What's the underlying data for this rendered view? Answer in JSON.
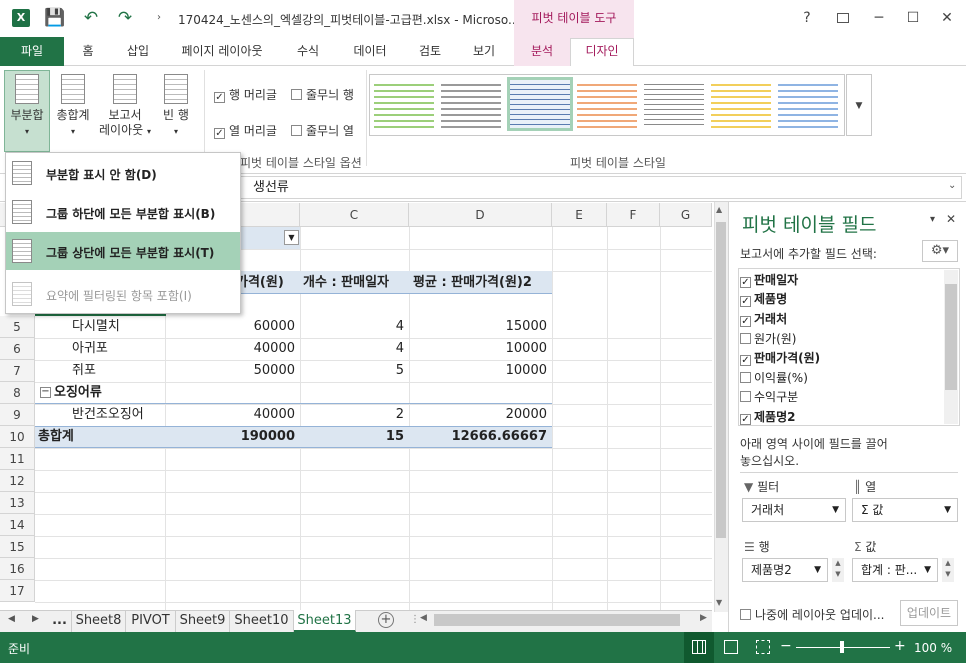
{
  "app": {
    "icon": "X",
    "title": "170424_노센스의_엑셀강의_피벗테이블-고급편.xlsx - Microso...",
    "context_group": "피벗 테이블 도구"
  },
  "window": {
    "help": "?",
    "restore_icon": "restore-icon",
    "minimize": "─",
    "maximize": "☐",
    "close": "✕"
  },
  "tabs": [
    "파일",
    "홈",
    "삽입",
    "페이지 레이아웃",
    "수식",
    "데이터",
    "검토",
    "보기",
    "분석",
    "디자인"
  ],
  "ribbon": {
    "subtotal": "부분합",
    "grand_total": "총합계",
    "report_layout_1": "보고서",
    "report_layout_2": "레이아웃",
    "blank_rows_1": "빈 행",
    "options": [
      "행 머리글",
      "줄무늬 행",
      "열 머리글",
      "줄무늬 열"
    ],
    "options_checked": [
      true,
      false,
      true,
      false
    ],
    "group_options": "피벗 테이블 스타일 옵션",
    "group_styles": "피벗 테이블 스타일"
  },
  "menu": {
    "items": [
      "부분합 표시 안 함(D)",
      "그룹 하단에 모든 부분합 표시(B)",
      "그룹 상단에 모든 부분합 표시(T)",
      "요약에 필터링된 항목 포함(I)"
    ]
  },
  "formula": {
    "value": "생선류"
  },
  "grid": {
    "columns": [
      "C",
      "D",
      "E",
      "F",
      "G"
    ],
    "rows": [
      "5",
      "6",
      "7",
      "8",
      "9",
      "10",
      "11",
      "12",
      "13",
      "14",
      "15",
      "16",
      "17"
    ],
    "header": {
      "b": "가격(원)",
      "c": "개수 : 판매일자",
      "d": "평균 : 판매가격(원)2"
    },
    "data": [
      {
        "a": "다시멸치",
        "b": "60000",
        "c": "4",
        "d": "15000"
      },
      {
        "a": "아귀포",
        "b": "40000",
        "c": "4",
        "d": "10000"
      },
      {
        "a": "쥐포",
        "b": "50000",
        "c": "5",
        "d": "10000"
      },
      {
        "a": "오징어류",
        "b": "",
        "c": "",
        "d": ""
      },
      {
        "a": "반건조오징어",
        "b": "40000",
        "c": "2",
        "d": "20000"
      },
      {
        "a": "총합계",
        "b": "190000",
        "c": "15",
        "d": "12666.66667"
      }
    ],
    "collapse": "⊟"
  },
  "pane": {
    "title": "피벗 테이블 필드",
    "subtitle": "보고서에 추가할 필드 선택:",
    "fields": [
      {
        "name": "판매일자",
        "checked": true
      },
      {
        "name": "제품명",
        "checked": true
      },
      {
        "name": "거래처",
        "checked": true
      },
      {
        "name": "원가(원)",
        "checked": false
      },
      {
        "name": "판매가격(원)",
        "checked": true
      },
      {
        "name": "이익률(%)",
        "checked": false
      },
      {
        "name": "수익구분",
        "checked": false
      },
      {
        "name": "제품명2",
        "checked": true
      }
    ],
    "drag_hint_1": "아래 영역 사이에 필드를 끌어",
    "drag_hint_2": "놓으십시오.",
    "areas": {
      "filter": "필터",
      "columns": "열",
      "rows": "행",
      "values": "값"
    },
    "filter_value": "거래처",
    "columns_value": "Σ 값",
    "rows_value": "제품명2",
    "values_value": "합계 : 판...",
    "defer": "나중에 레이아웃 업데이...",
    "update": "업데이트"
  },
  "sheets": [
    "...",
    "Sheet8",
    "PIVOT",
    "Sheet9",
    "Sheet10",
    "Sheet13"
  ],
  "status": {
    "ready": "준비",
    "zoom": "100 %",
    "minus": "−",
    "plus": "+"
  }
}
